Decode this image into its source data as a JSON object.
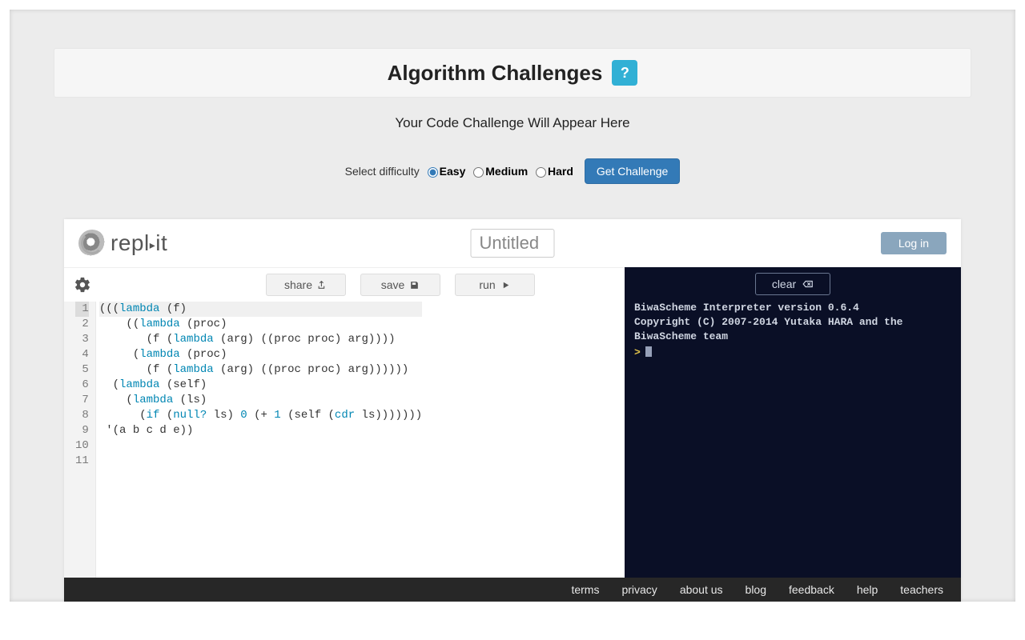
{
  "header": {
    "title": "Algorithm Challenges",
    "help_symbol": "?",
    "subtitle": "Your Code Challenge Will Appear Here"
  },
  "difficulty": {
    "label": "Select difficulty",
    "options": {
      "easy": "Easy",
      "medium": "Medium",
      "hard": "Hard"
    },
    "selected": "easy",
    "button": "Get Challenge"
  },
  "repl": {
    "logo_text": "repl",
    "logo_suffix": "it",
    "title_value": "Untitled",
    "login": "Log in"
  },
  "editor_toolbar": {
    "share": "share",
    "save": "save",
    "run": "run"
  },
  "code": {
    "lines": [
      "(((lambda (f)",
      "    ((lambda (proc)",
      "       (f (lambda (arg) ((proc proc) arg))))",
      "     (lambda (proc)",
      "       (f (lambda (arg) ((proc proc) arg))))))",
      "  (lambda (self)",
      "    (lambda (ls)",
      "      (if (null? ls) 0 (+ 1 (self (cdr ls)))))))",
      " '(a b c d e))",
      "",
      ""
    ]
  },
  "terminal": {
    "clear": "clear",
    "line1": "BiwaScheme Interpreter version 0.6.4",
    "line2": "Copyright (C) 2007-2014 Yutaka HARA and the BiwaScheme team",
    "prompt": ">"
  },
  "footer": {
    "links": [
      "terms",
      "privacy",
      "about us",
      "blog",
      "feedback",
      "help",
      "teachers"
    ]
  }
}
